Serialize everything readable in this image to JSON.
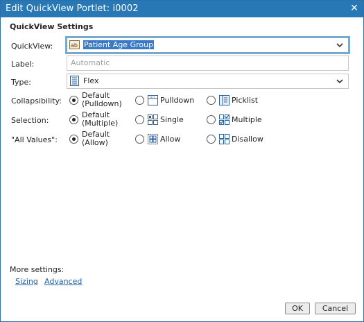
{
  "window": {
    "title": "Edit QuickView Portlet: i0002"
  },
  "section": {
    "title": "QuickView Settings"
  },
  "quickview": {
    "label": "QuickView:",
    "value": "Patient Age Group"
  },
  "label_field": {
    "label": "Label:",
    "placeholder": "Automatic"
  },
  "type": {
    "label": "Type:",
    "value": "Flex"
  },
  "collapsibility": {
    "label": "Collapsibility:",
    "options": [
      {
        "line1": "Default",
        "line2": "(Pulldown)",
        "checked": true
      },
      {
        "label": "Pulldown",
        "icon": "pulldown-icon",
        "checked": false
      },
      {
        "label": "Picklist",
        "icon": "picklist-icon",
        "checked": false
      }
    ]
  },
  "selection": {
    "label": "Selection:",
    "options": [
      {
        "line1": "Default",
        "line2": "(Multiple)",
        "checked": true
      },
      {
        "label": "Single",
        "icon": "single-select-icon",
        "checked": false
      },
      {
        "label": "Multiple",
        "icon": "multiple-select-icon",
        "checked": false
      }
    ]
  },
  "all_values": {
    "label": "\"All Values\":",
    "options": [
      {
        "line1": "Default",
        "line2": "(Allow)",
        "checked": true
      },
      {
        "label": "Allow",
        "icon": "allow-icon",
        "checked": false
      },
      {
        "label": "Disallow",
        "icon": "disallow-icon",
        "checked": false
      }
    ]
  },
  "more_settings": {
    "label": "More settings:",
    "links": [
      "Sizing",
      "Advanced"
    ]
  },
  "buttons": {
    "ok": "OK",
    "cancel": "Cancel"
  },
  "colors": {
    "titlebar": "#2878b6",
    "selection": "#3a7ac5",
    "focus_border": "#7aa9cf",
    "link": "#1f5fa6"
  }
}
